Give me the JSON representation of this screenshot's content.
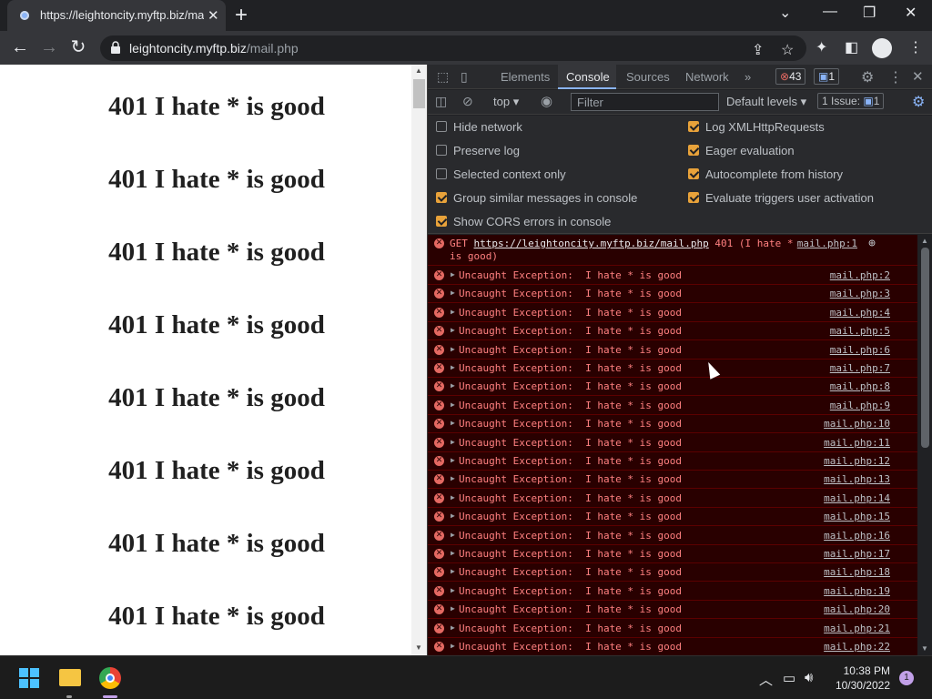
{
  "browser": {
    "tab_title": "https://leightoncity.myftp.biz/ma",
    "tab_close": "✕",
    "new_tab": "+",
    "url_host": "leightoncity.myftp.biz",
    "url_path": "/mail.php"
  },
  "page": {
    "headings": [
      "401 I hate * is good",
      "401 I hate * is good",
      "401 I hate * is good",
      "401 I hate * is good",
      "401 I hate * is good",
      "401 I hate * is good",
      "401 I hate * is good",
      "401 I hate * is good"
    ]
  },
  "devtools": {
    "tabs": [
      "Elements",
      "Console",
      "Sources",
      "Network"
    ],
    "active_tab": "Console",
    "error_count": "43",
    "message_count": "1",
    "context": "top",
    "filter_placeholder": "Filter",
    "levels": "Default levels",
    "issues_label": "1 Issue:",
    "issues_count": "1",
    "settings_left": [
      {
        "label": "Hide network",
        "checked": false
      },
      {
        "label": "Preserve log",
        "checked": false
      },
      {
        "label": "Selected context only",
        "checked": false
      },
      {
        "label": "Group similar messages in console",
        "checked": true
      },
      {
        "label": "Show CORS errors in console",
        "checked": true
      }
    ],
    "settings_right": [
      {
        "label": "Log XMLHttpRequests",
        "checked": true
      },
      {
        "label": "Eager evaluation",
        "checked": true
      },
      {
        "label": "Autocomplete from history",
        "checked": true
      },
      {
        "label": "Evaluate triggers user activation",
        "checked": true
      }
    ]
  },
  "console": {
    "first": {
      "method": "GET ",
      "url": "https://leightoncity.myftp.biz/mail.php",
      "status": " 401 (I hate * is good)",
      "source": "mail.php:1"
    },
    "exception_text": "Uncaught Exception:  I hate * is good",
    "rows": [
      {
        "source": "mail.php:2"
      },
      {
        "source": "mail.php:3"
      },
      {
        "source": "mail.php:4"
      },
      {
        "source": "mail.php:5"
      },
      {
        "source": "mail.php:6"
      },
      {
        "source": "mail.php:7"
      },
      {
        "source": "mail.php:8"
      },
      {
        "source": "mail.php:9"
      },
      {
        "source": "mail.php:10"
      },
      {
        "source": "mail.php:11"
      },
      {
        "source": "mail.php:12"
      },
      {
        "source": "mail.php:13"
      },
      {
        "source": "mail.php:14"
      },
      {
        "source": "mail.php:15"
      },
      {
        "source": "mail.php:16"
      },
      {
        "source": "mail.php:17"
      },
      {
        "source": "mail.php:18"
      },
      {
        "source": "mail.php:19"
      },
      {
        "source": "mail.php:20"
      },
      {
        "source": "mail.php:21"
      },
      {
        "source": "mail.php:22"
      }
    ]
  },
  "taskbar": {
    "time": "10:38 PM",
    "date": "10/30/2022",
    "notification_count": "1"
  },
  "colors": {
    "console_error_bg": "#290000",
    "error_text": "#ff8080",
    "checkbox_on": "#e8a23a",
    "accent": "#8ab4f8"
  }
}
